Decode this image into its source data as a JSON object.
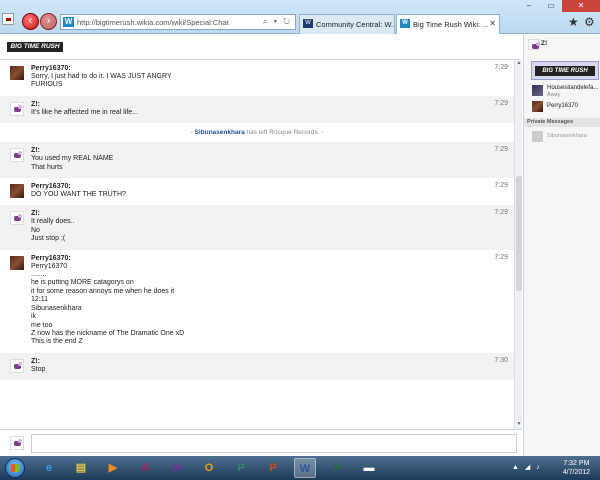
{
  "browser": {
    "url": "http://bigtimerush.wikia.com/wiki/Special:Chat",
    "address_controls": "⌕ ▾ ↻",
    "tabs": [
      {
        "label": "Community Central: W...",
        "icon": "W"
      },
      {
        "label": "Big Time Rush Wiki: ...",
        "icon": "W"
      }
    ],
    "window_controls": [
      "–",
      "▭",
      "✕"
    ]
  },
  "logo_text": "BIG TIME RUSH",
  "messages": [
    {
      "user": "Perry16370:",
      "time": "7:29",
      "avatar": "perry",
      "lines": [
        "Sorry, I just had to do it. I WAS JUST ANGRY",
        "FURIOUS"
      ]
    },
    {
      "user": "Z!:",
      "time": "7:29",
      "avatar": "z",
      "lines": [
        "It's like he affected me in real life..."
      ]
    },
    {
      "event": true,
      "who": "Sibunasenkhara",
      "text": "has left Rocque Records."
    },
    {
      "user": "Z!:",
      "time": "7:29",
      "avatar": "z",
      "lines": [
        "You used my REAL NAME",
        "That hurts"
      ]
    },
    {
      "user": "Perry16370:",
      "time": "7:29",
      "avatar": "perry",
      "lines": [
        "DO YOU WANT THE TRUTH?"
      ]
    },
    {
      "user": "Z!:",
      "time": "7:29",
      "avatar": "z",
      "lines": [
        "It really does..",
        "No",
        "Just stop ;("
      ]
    },
    {
      "user": "Perry16370:",
      "time": "7:29",
      "avatar": "perry",
      "lines": [
        "Perry16370",
        "........",
        "he is putting MORE catagorys on",
        "it for some reason annoys me when he does it",
        "12:11",
        "Sibunasenkhara",
        "ik",
        "me too",
        "Z now has the nickname of The Dramatic One xD",
        "This is the end Z"
      ]
    },
    {
      "user": "Z!:",
      "time": "7:30",
      "avatar": "z",
      "lines": [
        "Stop"
      ]
    }
  ],
  "rail": {
    "me": "Z!",
    "users": [
      {
        "name": "Housesitandelefa...",
        "status": "Away"
      },
      {
        "name": "Perry16370",
        "status": ""
      }
    ],
    "private_messages_label": "Private Messages",
    "private_users": [
      "Sibunasenkhara"
    ]
  },
  "taskbar": {
    "apps": [
      {
        "name": "internet-explorer-icon",
        "glyph": "e",
        "color": "#3b9be0"
      },
      {
        "name": "file-explorer-icon",
        "glyph": "▤",
        "color": "#e7c34a"
      },
      {
        "name": "media-player-icon",
        "glyph": "▶",
        "color": "#f08a1a"
      },
      {
        "name": "access-icon",
        "glyph": "A",
        "color": "#b0205a"
      },
      {
        "name": "onenote-icon",
        "glyph": "N",
        "color": "#7d2d9a"
      },
      {
        "name": "outlook-icon",
        "glyph": "O",
        "color": "#e8a20d"
      },
      {
        "name": "publisher-icon",
        "glyph": "P",
        "color": "#2a8a6a"
      },
      {
        "name": "powerpoint-icon",
        "glyph": "P",
        "color": "#d24a1a"
      },
      {
        "name": "word-icon",
        "glyph": "W",
        "color": "#2b5797"
      },
      {
        "name": "excel-icon",
        "glyph": "X",
        "color": "#1e7145"
      },
      {
        "name": "chat-window-icon",
        "glyph": "▬",
        "color": "#ffffff"
      }
    ],
    "time": "7:32 PM",
    "date": "4/7/2012"
  }
}
